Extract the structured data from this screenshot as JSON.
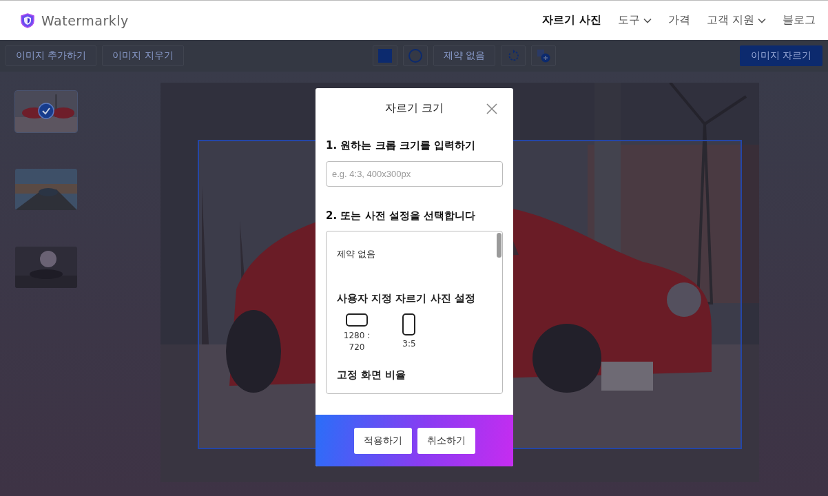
{
  "header": {
    "logo_text": "Watermarkly",
    "nav": [
      {
        "label": "자르기 사진",
        "selected": true,
        "dropdown": false
      },
      {
        "label": "도구",
        "selected": false,
        "dropdown": true
      },
      {
        "label": "가격",
        "selected": false,
        "dropdown": false
      },
      {
        "label": "고객 지원",
        "selected": false,
        "dropdown": true
      },
      {
        "label": "블로그",
        "selected": false,
        "dropdown": false
      }
    ]
  },
  "toolbar": {
    "left_buttons": [
      "이미지 추가하기",
      "이미지 지우기"
    ],
    "shapes": [
      {
        "kind": "square",
        "selected": true
      },
      {
        "kind": "circle",
        "selected": false
      }
    ],
    "ratio_button": "제약 없음",
    "crop_button": "이미지 자르기"
  },
  "thumbnails": [
    {
      "selected": true
    },
    {
      "selected": false
    },
    {
      "selected": false
    }
  ],
  "dialog": {
    "title": "자르기 크기",
    "step1": "1. 원하는 크롭 크기를 입력하기",
    "size_input": {
      "placeholder": "e.g. 4:3, 400x300px"
    },
    "step2": "2. 또는 사전 설정을 선택합니다",
    "presets": [
      {
        "kind": "option",
        "label": "제약 없음"
      },
      {
        "kind": "heading",
        "label": "사용자 지정 자르기 사진 설정"
      },
      {
        "kind": "ratios",
        "items": [
          {
            "kind": "wide",
            "label": "1280 : 720"
          },
          {
            "kind": "tall",
            "label": "3:5"
          }
        ]
      },
      {
        "kind": "heading",
        "label": "고정 화면 비율"
      }
    ],
    "buttons": [
      "적용하기",
      "취소하기"
    ]
  }
}
